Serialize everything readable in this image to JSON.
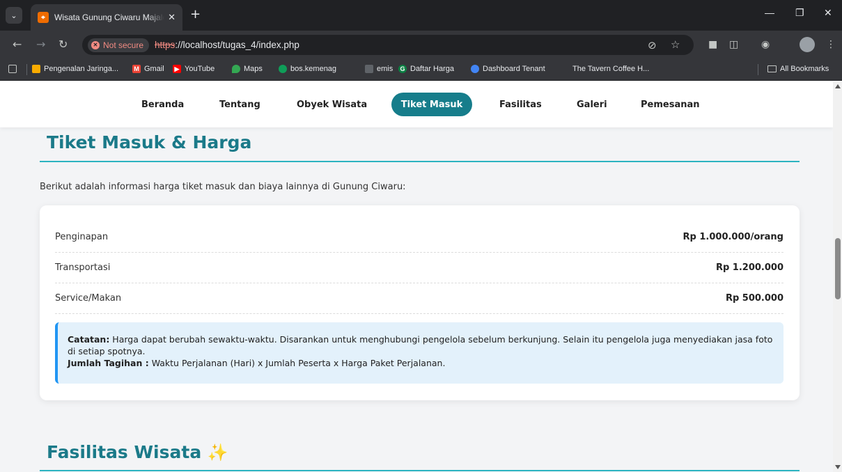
{
  "browser": {
    "tab_title": "Wisata Gunung Ciwaru Majalengka",
    "security_label": "Not secure",
    "url_scheme": "https",
    "url_rest": "://localhost/tugas_4/index.php",
    "bookmarks": [
      "Pengenalan Jaringa...",
      "Gmail",
      "YouTube",
      "Maps",
      "bos.kemenag",
      "emis",
      "Daftar Harga",
      "Dashboard Tenant",
      "The Tavern Coffee H...",
      "All Bookmarks"
    ]
  },
  "nav": {
    "items": [
      "Beranda",
      "Tentang",
      "Obyek Wisata",
      "Tiket Masuk",
      "Fasilitas",
      "Galeri",
      "Pemesanan"
    ],
    "active": "Tiket Masuk"
  },
  "tiket": {
    "title": "Tiket Masuk & Harga",
    "intro": "Berikut adalah informasi harga tiket masuk dan biaya lainnya di Gunung Ciwaru:",
    "rows": [
      {
        "label": "Penginapan",
        "price": "Rp 1.000.000/orang"
      },
      {
        "label": "Transportasi",
        "price": "Rp 1.200.000"
      },
      {
        "label": "Service/Makan",
        "price": "Rp 500.000"
      }
    ],
    "note": {
      "catatan_label": "Catatan:",
      "catatan_text": " Harga dapat berubah sewaktu-waktu. Disarankan untuk menghubungi pengelola sebelum berkunjung. Selain itu pengelola juga menyediakan jasa foto di setiap spotnya.",
      "jumlah_label": "Jumlah Tagihan :",
      "jumlah_text": " Waktu Perjalanan (Hari) x Jumlah Peserta x Harga Paket Perjalanan."
    }
  },
  "fasilitas": {
    "title": "Fasilitas Wisata",
    "emoji": "✨"
  },
  "colors": {
    "accent": "#167d8b",
    "heading": "#1b7a89",
    "rule": "#2bb3c0",
    "note_bg": "#e3f1fb",
    "note_border": "#2196f3"
  }
}
